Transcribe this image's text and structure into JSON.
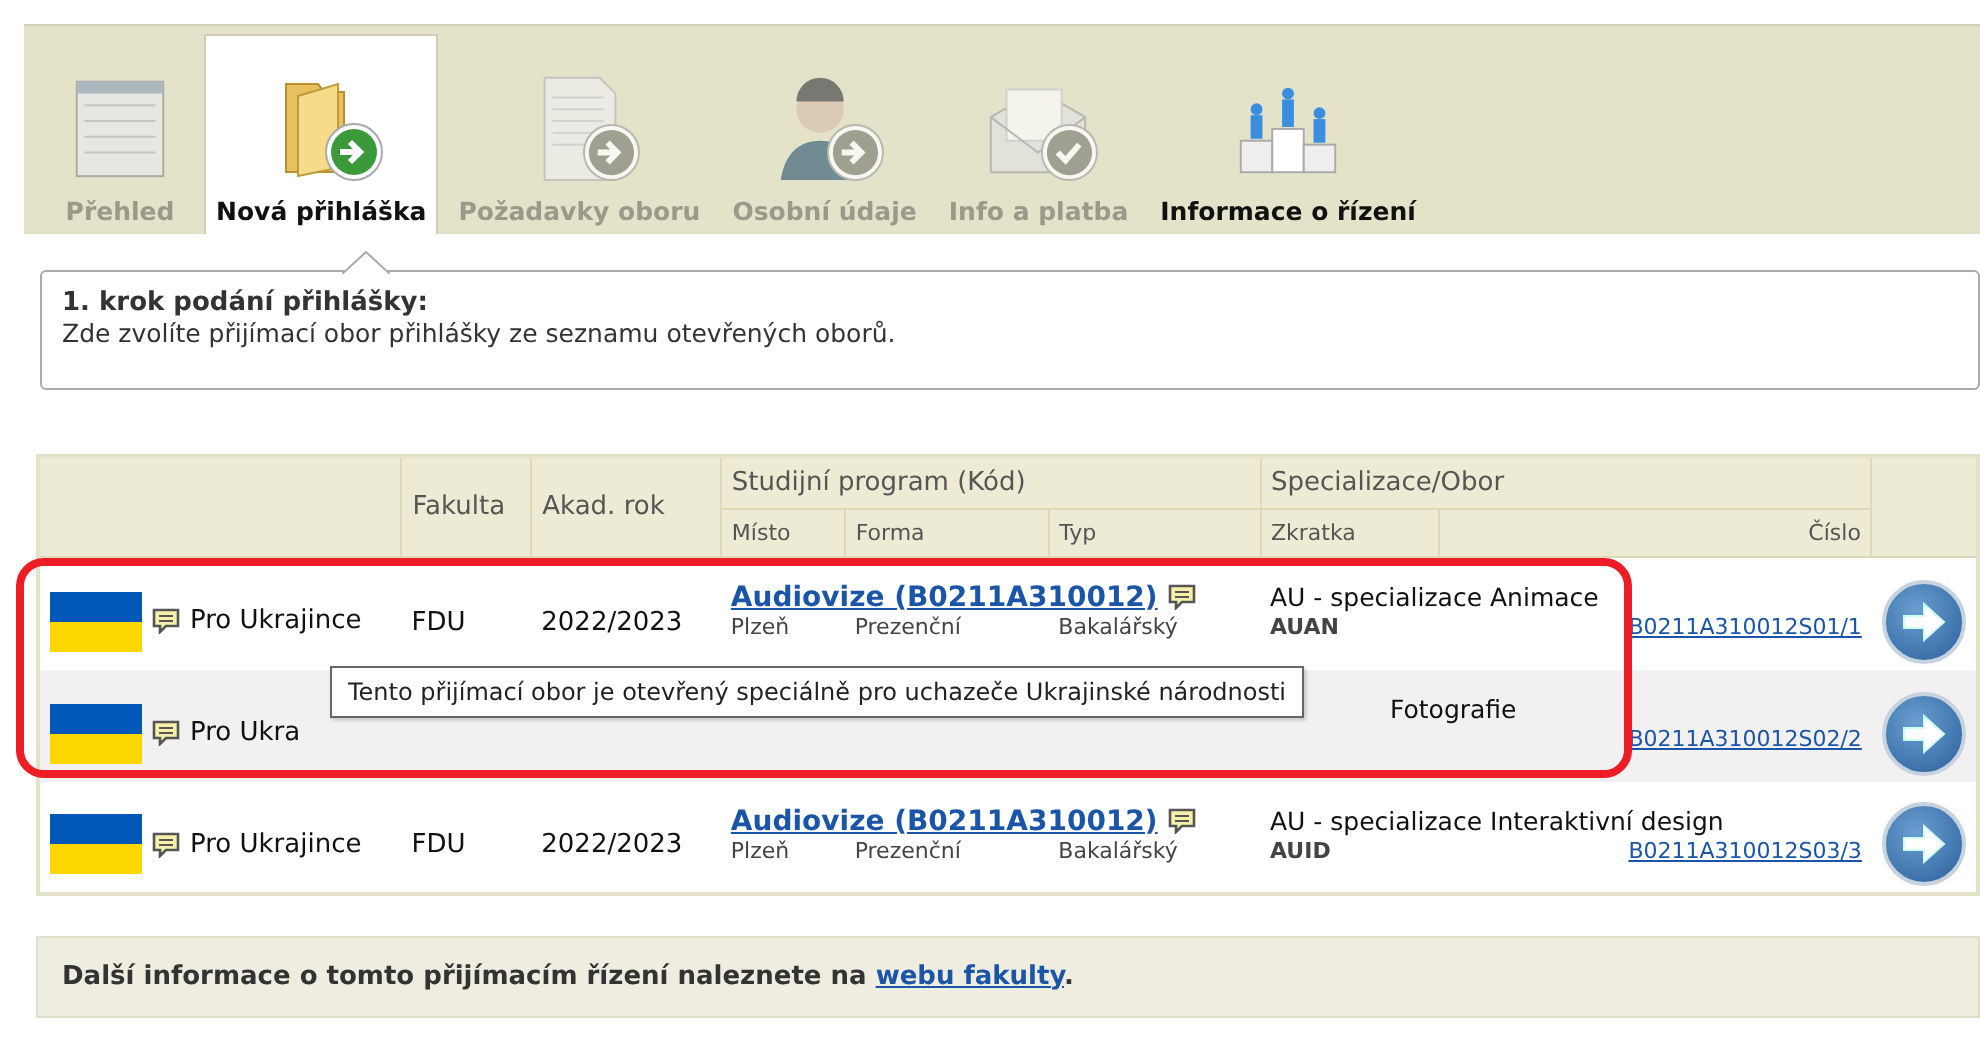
{
  "tabs": [
    {
      "label": "Přehled",
      "selected": false,
      "disabled": true
    },
    {
      "label": "Nová přihláška",
      "selected": true,
      "disabled": false
    },
    {
      "label": "Požadavky oboru",
      "selected": false,
      "disabled": true
    },
    {
      "label": "Osobní údaje",
      "selected": false,
      "disabled": true
    },
    {
      "label": "Info a platba",
      "selected": false,
      "disabled": true
    },
    {
      "label": "Informace o řízení",
      "selected": false,
      "disabled": false
    }
  ],
  "step": {
    "title": "1. krok podání přihlášky:",
    "text": "Zde zvolíte přijímací obor přihlášky ze seznamu otevřených oborů."
  },
  "table": {
    "columns": [
      "Fakulta",
      "Akad. rok",
      "Studijní program (Kód)",
      "Specializace/Obor"
    ],
    "subcolumns": [
      "Místo",
      "Forma",
      "Typ",
      "Zkratka",
      "Číslo"
    ],
    "rows": [
      {
        "label": "Pro Ukrajince",
        "faculty": "FDU",
        "year": "2022/2023",
        "program": "Audiovize (B0211A310012)",
        "specialization": "AU - specializace Animace",
        "place": "Plzeň",
        "form": "Prezenční",
        "type": "Bakalářský",
        "abbr": "AUAN",
        "number": "B0211A310012S01/1",
        "tooltip": "Tento přijímací obor je otevřený speciálně pro uchazeče Ukrajinské národnosti"
      },
      {
        "label": "Pro Ukra",
        "specialization": "Fotografie",
        "number": "B0211A310012S02/2"
      },
      {
        "label": "Pro Ukrajince",
        "faculty": "FDU",
        "year": "2022/2023",
        "program": "Audiovize (B0211A310012)",
        "specialization": "AU - specializace Interaktivní design",
        "place": "Plzeň",
        "form": "Prezenční",
        "type": "Bakalářský",
        "abbr": "AUID",
        "number": "B0211A310012S03/3"
      }
    ]
  },
  "footer": {
    "text": "Další informace o tomto přijímacím řízení naleznete na ",
    "link": "webu fakulty",
    "end": "."
  }
}
